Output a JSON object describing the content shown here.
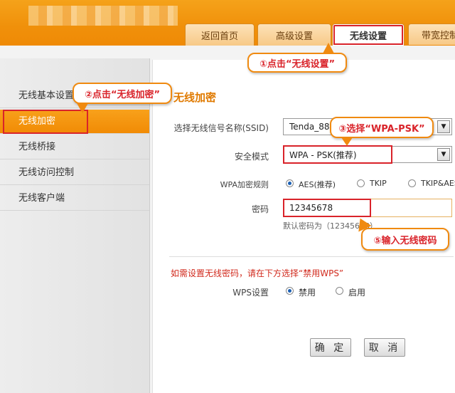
{
  "header": {
    "tabs": [
      {
        "label": "返回首页"
      },
      {
        "label": "高级设置"
      },
      {
        "label": "无线设置",
        "active": true
      },
      {
        "label": "带宽控制"
      }
    ]
  },
  "sidebar": {
    "items": [
      {
        "label": "无线基本设置"
      },
      {
        "label": "无线加密",
        "active": true
      },
      {
        "label": "无线桥接"
      },
      {
        "label": "无线访问控制"
      },
      {
        "label": "无线客户端"
      }
    ]
  },
  "main": {
    "title": "无线加密",
    "ssid_label": "选择无线信号名称(SSID)",
    "ssid_value": "Tenda_88",
    "security_label": "安全模式",
    "security_value": "WPA - PSK(推荐)",
    "wpa_rule_label": "WPA加密规则",
    "wpa_options": [
      "AES(推荐)",
      "TKIP",
      "TKIP&AES"
    ],
    "wpa_selected": "AES(推荐)",
    "password_label": "密码",
    "password_value": "12345678",
    "password_hint": "默认密码为（12345678）",
    "note": "如需设置无线密码，请在下方选择“禁用WPS”",
    "wps_label": "WPS设置",
    "wps_options": [
      "禁用",
      "启用"
    ],
    "wps_selected": "禁用",
    "confirm_button": "确 定",
    "cancel_button": "取 消"
  },
  "callouts": {
    "step1": "①点击“无线设置”",
    "step2": "②点击“无线加密”",
    "step3": "③选择“WPA-PSK”",
    "step5": "⑤输入无线密码"
  },
  "colors": {
    "brand_orange": "#f18b05",
    "highlight_red": "#d9232a",
    "title_orange": "#e07a00"
  }
}
